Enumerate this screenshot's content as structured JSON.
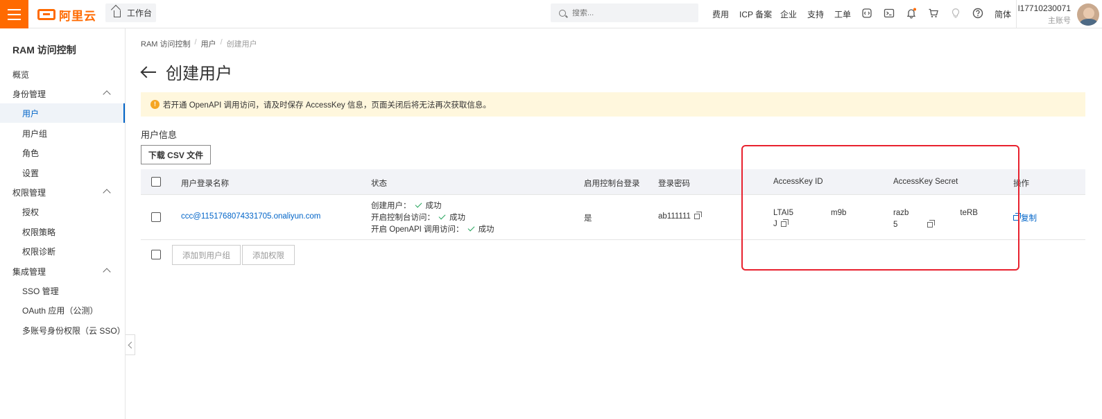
{
  "header": {
    "logo_text": "阿里云",
    "workbench": "工作台",
    "search_placeholder": "搜索...",
    "nav": [
      "费用",
      "ICP 备案",
      "企业",
      "支持",
      "工单"
    ],
    "lang": "简体",
    "user_id": "l17710230071",
    "user_role": "主账号",
    "icons": [
      "code-icon",
      "terminal-icon",
      "bell-icon",
      "cart-icon",
      "bulb-icon",
      "help-icon"
    ],
    "brand_color": "#ff6a00"
  },
  "sidebar": {
    "title": "RAM 访问控制",
    "overview": "概览",
    "groups": [
      {
        "label": "身份管理",
        "items": [
          "用户",
          "用户组",
          "角色",
          "设置"
        ]
      },
      {
        "label": "权限管理",
        "items": [
          "授权",
          "权限策略",
          "权限诊断"
        ]
      },
      {
        "label": "集成管理",
        "items": [
          "SSO 管理",
          "OAuth 应用（公测）",
          "多账号身份权限（云 SSO）"
        ]
      }
    ],
    "active_item": "用户"
  },
  "breadcrumb": [
    "RAM 访问控制",
    "用户",
    "创建用户"
  ],
  "page_title": "创建用户",
  "notice": "若开通 OpenAPI 调用访问，请及时保存 AccessKey 信息，页面关闭后将无法再次获取信息。",
  "section_title": "用户信息",
  "download_csv": "下载 CSV 文件",
  "table": {
    "headers": [
      "用户登录名称",
      "状态",
      "启用控制台登录",
      "登录密码",
      "AccessKey ID",
      "AccessKey Secret",
      "操作"
    ],
    "row": {
      "login_name": "ccc@1151768074331705.onaliyun.com",
      "status": [
        {
          "label": "创建用户：",
          "result": "成功"
        },
        {
          "label": "开启控制台访问：",
          "result": "成功"
        },
        {
          "label": "开启 OpenAPI 调用访问：",
          "result": "成功"
        }
      ],
      "console_login": "是",
      "password": "ab111111",
      "ak_id_line1a": "LTAI5",
      "ak_id_line1b": "m9b",
      "ak_id_line2": "J",
      "ak_secret_line1a": "razb",
      "ak_secret_line1b": "teRB",
      "ak_secret_line2": "5",
      "action": "复制"
    }
  },
  "bottom_buttons": [
    "添加到用户组",
    "添加权限"
  ]
}
